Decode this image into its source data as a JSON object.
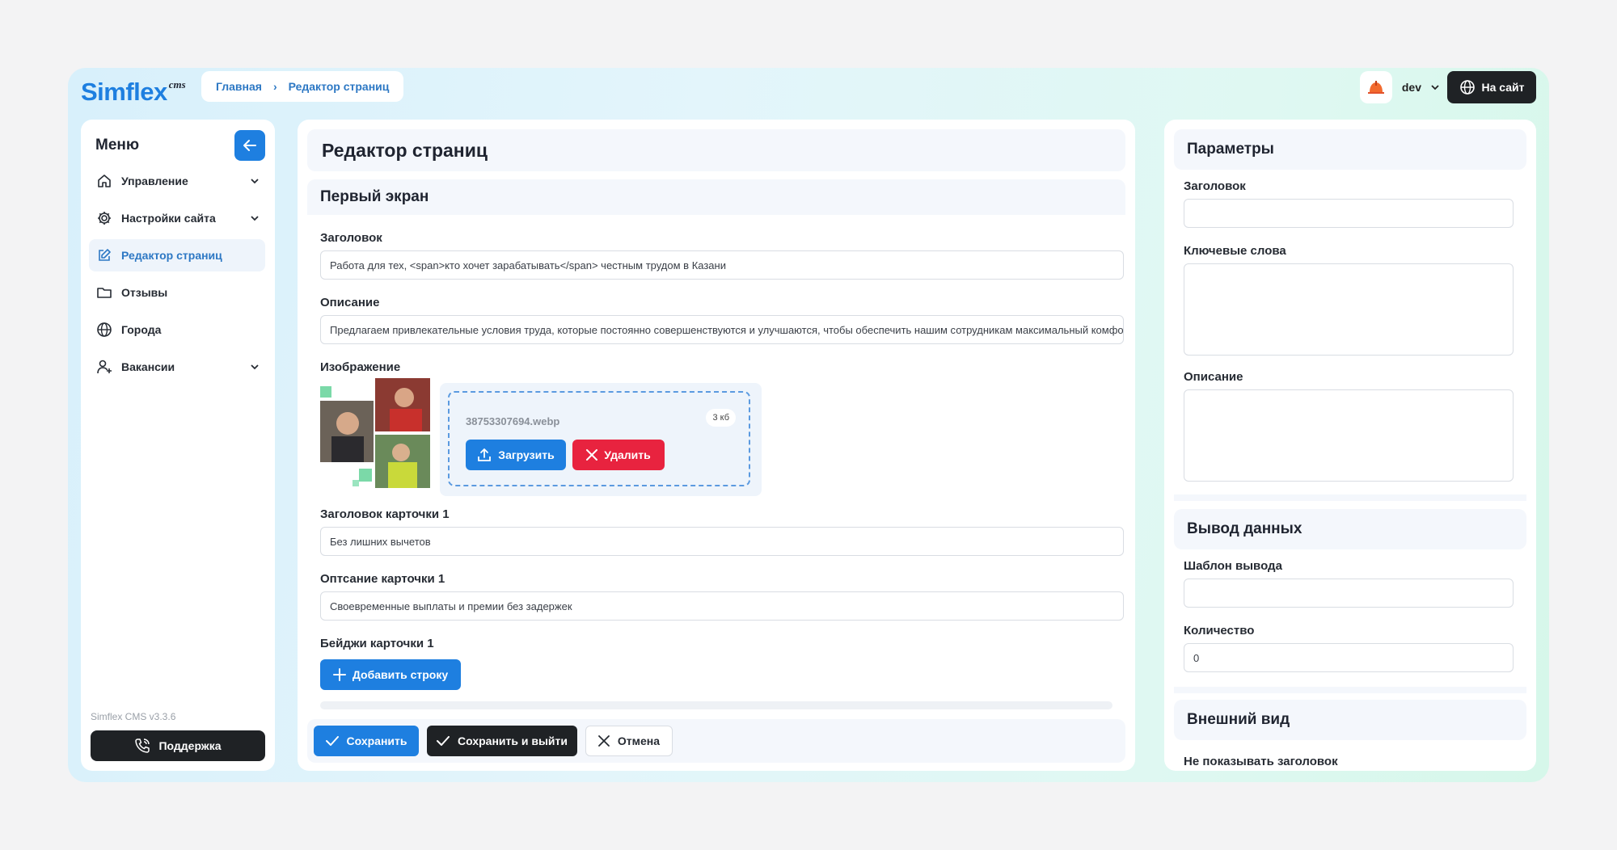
{
  "brand": {
    "name": "Simflex",
    "suffix": "cms"
  },
  "breadcrumb": [
    "Главная",
    "Редактор страниц"
  ],
  "user": {
    "name": "dev"
  },
  "header": {
    "site_button": "На сайт"
  },
  "sidebar": {
    "title": "Меню",
    "items": [
      {
        "label": "Управление",
        "icon": "home-icon",
        "chevron": true
      },
      {
        "label": "Настройки сайта",
        "icon": "gear-icon",
        "chevron": true
      },
      {
        "label": "Редактор страниц",
        "icon": "edit-icon",
        "chevron": false,
        "active": true
      },
      {
        "label": "Отзывы",
        "icon": "folder-icon",
        "chevron": false
      },
      {
        "label": "Города",
        "icon": "globe-icon",
        "chevron": false
      },
      {
        "label": "Вакансии",
        "icon": "user-add-icon",
        "chevron": true
      }
    ],
    "version": "Simflex CMS v3.3.6",
    "support": "Поддержка"
  },
  "main": {
    "page_title": "Редактор страниц",
    "section_title": "Первый экран",
    "title_label": "Заголовок",
    "title_value": "Работа для тех, <span>кто хочет зарабатывать</span> честным трудом в Казани",
    "desc_label": "Описание",
    "desc_value": "Предлагаем привлекательные условия труда, которые постоянно совершенствуются и улучшаются, чтобы обеспечить нашим сотрудникам максимальный комфорт",
    "image_label": "Изображение",
    "image": {
      "file_name": "38753307694.webp",
      "file_size": "3 кб",
      "upload": "Загрузить",
      "delete": "Удалить"
    },
    "card_title_label": "Заголовок карточки 1",
    "card_title_value": "Без лишних вычетов",
    "card_desc_label": "Оптсание карточки 1",
    "card_desc_value": "Своевременные выплаты и премии без задержек",
    "card_badges_label": "Бейджи карточки 1",
    "add_row": "Добавить строку",
    "save": "Сохранить",
    "save_exit": "Сохранить и выйти",
    "cancel": "Отмена"
  },
  "params": {
    "title": "Параметры",
    "heading_label": "Заголовок",
    "heading_value": "",
    "keywords_label": "Ключевые слова",
    "description_label": "Описание",
    "output_title": "Вывод данных",
    "template_label": "Шаблон вывода",
    "template_value": "",
    "count_label": "Количество",
    "count_value": "0",
    "appearance_title": "Внешний вид",
    "hide_title_label": "Не показывать заголовок"
  },
  "colors": {
    "accent": "#1e7fe0",
    "danger": "#e8233f",
    "dark": "#1f2225"
  }
}
